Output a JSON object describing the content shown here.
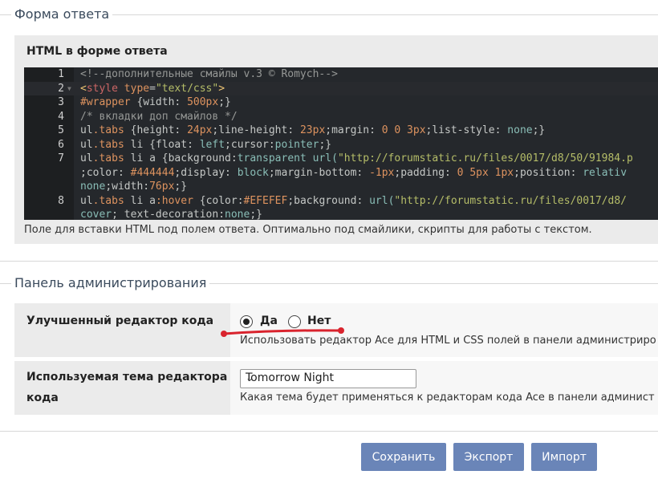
{
  "sections": {
    "answer_form": {
      "legend": "Форма ответа",
      "field_title": "HTML в форме ответа",
      "hint": "Поле для вставки HTML под полем ответа. Оптимально под смайлики, скрипты для работы с текстом.",
      "code_lines": [
        {
          "n": "1",
          "segments": [
            {
              "t": "<!--дополнительные смайлы v.3 © Romych-->",
              "c": "c-comment"
            }
          ]
        },
        {
          "n": "2",
          "segments": [
            {
              "t": "<",
              "c": "c-tag"
            },
            {
              "t": "style",
              "c": "c-tagname"
            },
            {
              "t": " type",
              "c": "c-attr"
            },
            {
              "t": "=",
              "c": "c-text"
            },
            {
              "t": "\"text/css\"",
              "c": "c-str"
            },
            {
              "t": ">",
              "c": "c-tag"
            }
          ]
        },
        {
          "n": "3",
          "segments": [
            {
              "t": "#wrapper",
              "c": "c-sel"
            },
            {
              "t": " {",
              "c": "c-text"
            },
            {
              "t": "width",
              "c": "c-prop"
            },
            {
              "t": ": ",
              "c": "c-text"
            },
            {
              "t": "500px",
              "c": "c-num"
            },
            {
              "t": ";}",
              "c": "c-text"
            }
          ]
        },
        {
          "n": "4",
          "segments": [
            {
              "t": "/* вкладки доп смайлов */",
              "c": "c-comment"
            }
          ]
        },
        {
          "n": "5",
          "segments": [
            {
              "t": "ul",
              "c": "c-text"
            },
            {
              "t": ".tabs",
              "c": "c-sel"
            },
            {
              "t": " {",
              "c": "c-text"
            },
            {
              "t": "height",
              "c": "c-prop"
            },
            {
              "t": ": ",
              "c": "c-text"
            },
            {
              "t": "24px",
              "c": "c-num"
            },
            {
              "t": ";",
              "c": "c-text"
            },
            {
              "t": "line-height",
              "c": "c-prop"
            },
            {
              "t": ": ",
              "c": "c-text"
            },
            {
              "t": "23px",
              "c": "c-num"
            },
            {
              "t": ";",
              "c": "c-text"
            },
            {
              "t": "margin",
              "c": "c-prop"
            },
            {
              "t": ": ",
              "c": "c-text"
            },
            {
              "t": "0 0 3px",
              "c": "c-num"
            },
            {
              "t": ";",
              "c": "c-text"
            },
            {
              "t": "list-style",
              "c": "c-prop"
            },
            {
              "t": ": ",
              "c": "c-text"
            },
            {
              "t": "none",
              "c": "c-val"
            },
            {
              "t": ";}",
              "c": "c-text"
            }
          ]
        },
        {
          "n": "6",
          "segments": [
            {
              "t": "ul",
              "c": "c-text"
            },
            {
              "t": ".tabs",
              "c": "c-sel"
            },
            {
              "t": " li {",
              "c": "c-text"
            },
            {
              "t": "float",
              "c": "c-prop"
            },
            {
              "t": ": ",
              "c": "c-text"
            },
            {
              "t": "left",
              "c": "c-val"
            },
            {
              "t": ";",
              "c": "c-text"
            },
            {
              "t": "cursor",
              "c": "c-prop"
            },
            {
              "t": ":",
              "c": "c-text"
            },
            {
              "t": "pointer",
              "c": "c-val"
            },
            {
              "t": ";}",
              "c": "c-text"
            }
          ]
        },
        {
          "n": "7",
          "segments": [
            {
              "t": "ul",
              "c": "c-text"
            },
            {
              "t": ".tabs",
              "c": "c-sel"
            },
            {
              "t": " li a {",
              "c": "c-text"
            },
            {
              "t": "background",
              "c": "c-prop"
            },
            {
              "t": ":",
              "c": "c-text"
            },
            {
              "t": "transparent ",
              "c": "c-val"
            },
            {
              "t": "url(",
              "c": "c-val"
            },
            {
              "t": "\"http://forumstatic.ru/files/0017/d8/50/91984.p",
              "c": "c-str"
            }
          ]
        },
        {
          "n": "",
          "segments": [
            {
              "t": ";",
              "c": "c-text"
            },
            {
              "t": "color",
              "c": "c-prop"
            },
            {
              "t": ": ",
              "c": "c-text"
            },
            {
              "t": "#444444",
              "c": "c-num"
            },
            {
              "t": ";",
              "c": "c-text"
            },
            {
              "t": "display",
              "c": "c-prop"
            },
            {
              "t": ": ",
              "c": "c-text"
            },
            {
              "t": "block",
              "c": "c-val"
            },
            {
              "t": ";",
              "c": "c-text"
            },
            {
              "t": "margin-bottom",
              "c": "c-prop"
            },
            {
              "t": ": ",
              "c": "c-text"
            },
            {
              "t": "-1px",
              "c": "c-num"
            },
            {
              "t": ";",
              "c": "c-text"
            },
            {
              "t": "padding",
              "c": "c-prop"
            },
            {
              "t": ": ",
              "c": "c-text"
            },
            {
              "t": "0 5px 1px",
              "c": "c-num"
            },
            {
              "t": ";",
              "c": "c-text"
            },
            {
              "t": "position",
              "c": "c-prop"
            },
            {
              "t": ": ",
              "c": "c-text"
            },
            {
              "t": "relativ",
              "c": "c-val"
            }
          ]
        },
        {
          "n": "",
          "segments": [
            {
              "t": "none",
              "c": "c-val"
            },
            {
              "t": ";",
              "c": "c-text"
            },
            {
              "t": "width",
              "c": "c-prop"
            },
            {
              "t": ":",
              "c": "c-text"
            },
            {
              "t": "76px",
              "c": "c-num"
            },
            {
              "t": ";}",
              "c": "c-text"
            }
          ]
        },
        {
          "n": "8",
          "segments": [
            {
              "t": "ul",
              "c": "c-text"
            },
            {
              "t": ".tabs",
              "c": "c-sel"
            },
            {
              "t": " li a",
              "c": "c-text"
            },
            {
              "t": ":hover",
              "c": "c-sel"
            },
            {
              "t": " {",
              "c": "c-text"
            },
            {
              "t": "color",
              "c": "c-prop"
            },
            {
              "t": ":",
              "c": "c-text"
            },
            {
              "t": "#EFEFEF",
              "c": "c-num"
            },
            {
              "t": ";",
              "c": "c-text"
            },
            {
              "t": "background",
              "c": "c-prop"
            },
            {
              "t": ": ",
              "c": "c-text"
            },
            {
              "t": "url(",
              "c": "c-val"
            },
            {
              "t": "\"http://forumstatic.ru/files/0017/d8/",
              "c": "c-str"
            }
          ]
        },
        {
          "n": "",
          "segments": [
            {
              "t": "cover",
              "c": "c-val"
            },
            {
              "t": "; ",
              "c": "c-text"
            },
            {
              "t": "text-decoration",
              "c": "c-prop"
            },
            {
              "t": ":",
              "c": "c-text"
            },
            {
              "t": "none",
              "c": "c-val"
            },
            {
              "t": ";}",
              "c": "c-text"
            }
          ]
        }
      ]
    },
    "admin_panel": {
      "legend": "Панель администрирования",
      "code_editor": {
        "label": "Улучшенный редактор кода",
        "option_yes": "Да",
        "option_no": "Нет",
        "selected": "Да",
        "description": "Использовать редактор Ace для HTML и CSS полей в панели администриро"
      },
      "theme": {
        "label_line1": "Используемая тема редактора",
        "label_line2": "кода",
        "selected": "Tomorrow Night",
        "description": "Какая тема будет применяться к редакторам кода Ace в панели админист"
      }
    }
  },
  "buttons": {
    "save": "Сохранить",
    "export": "Экспорт",
    "import": "Импорт"
  },
  "colors": {
    "button_bg": "#6a85b8",
    "editor_bg": "#25282c",
    "annotation_red": "#d9232d"
  }
}
